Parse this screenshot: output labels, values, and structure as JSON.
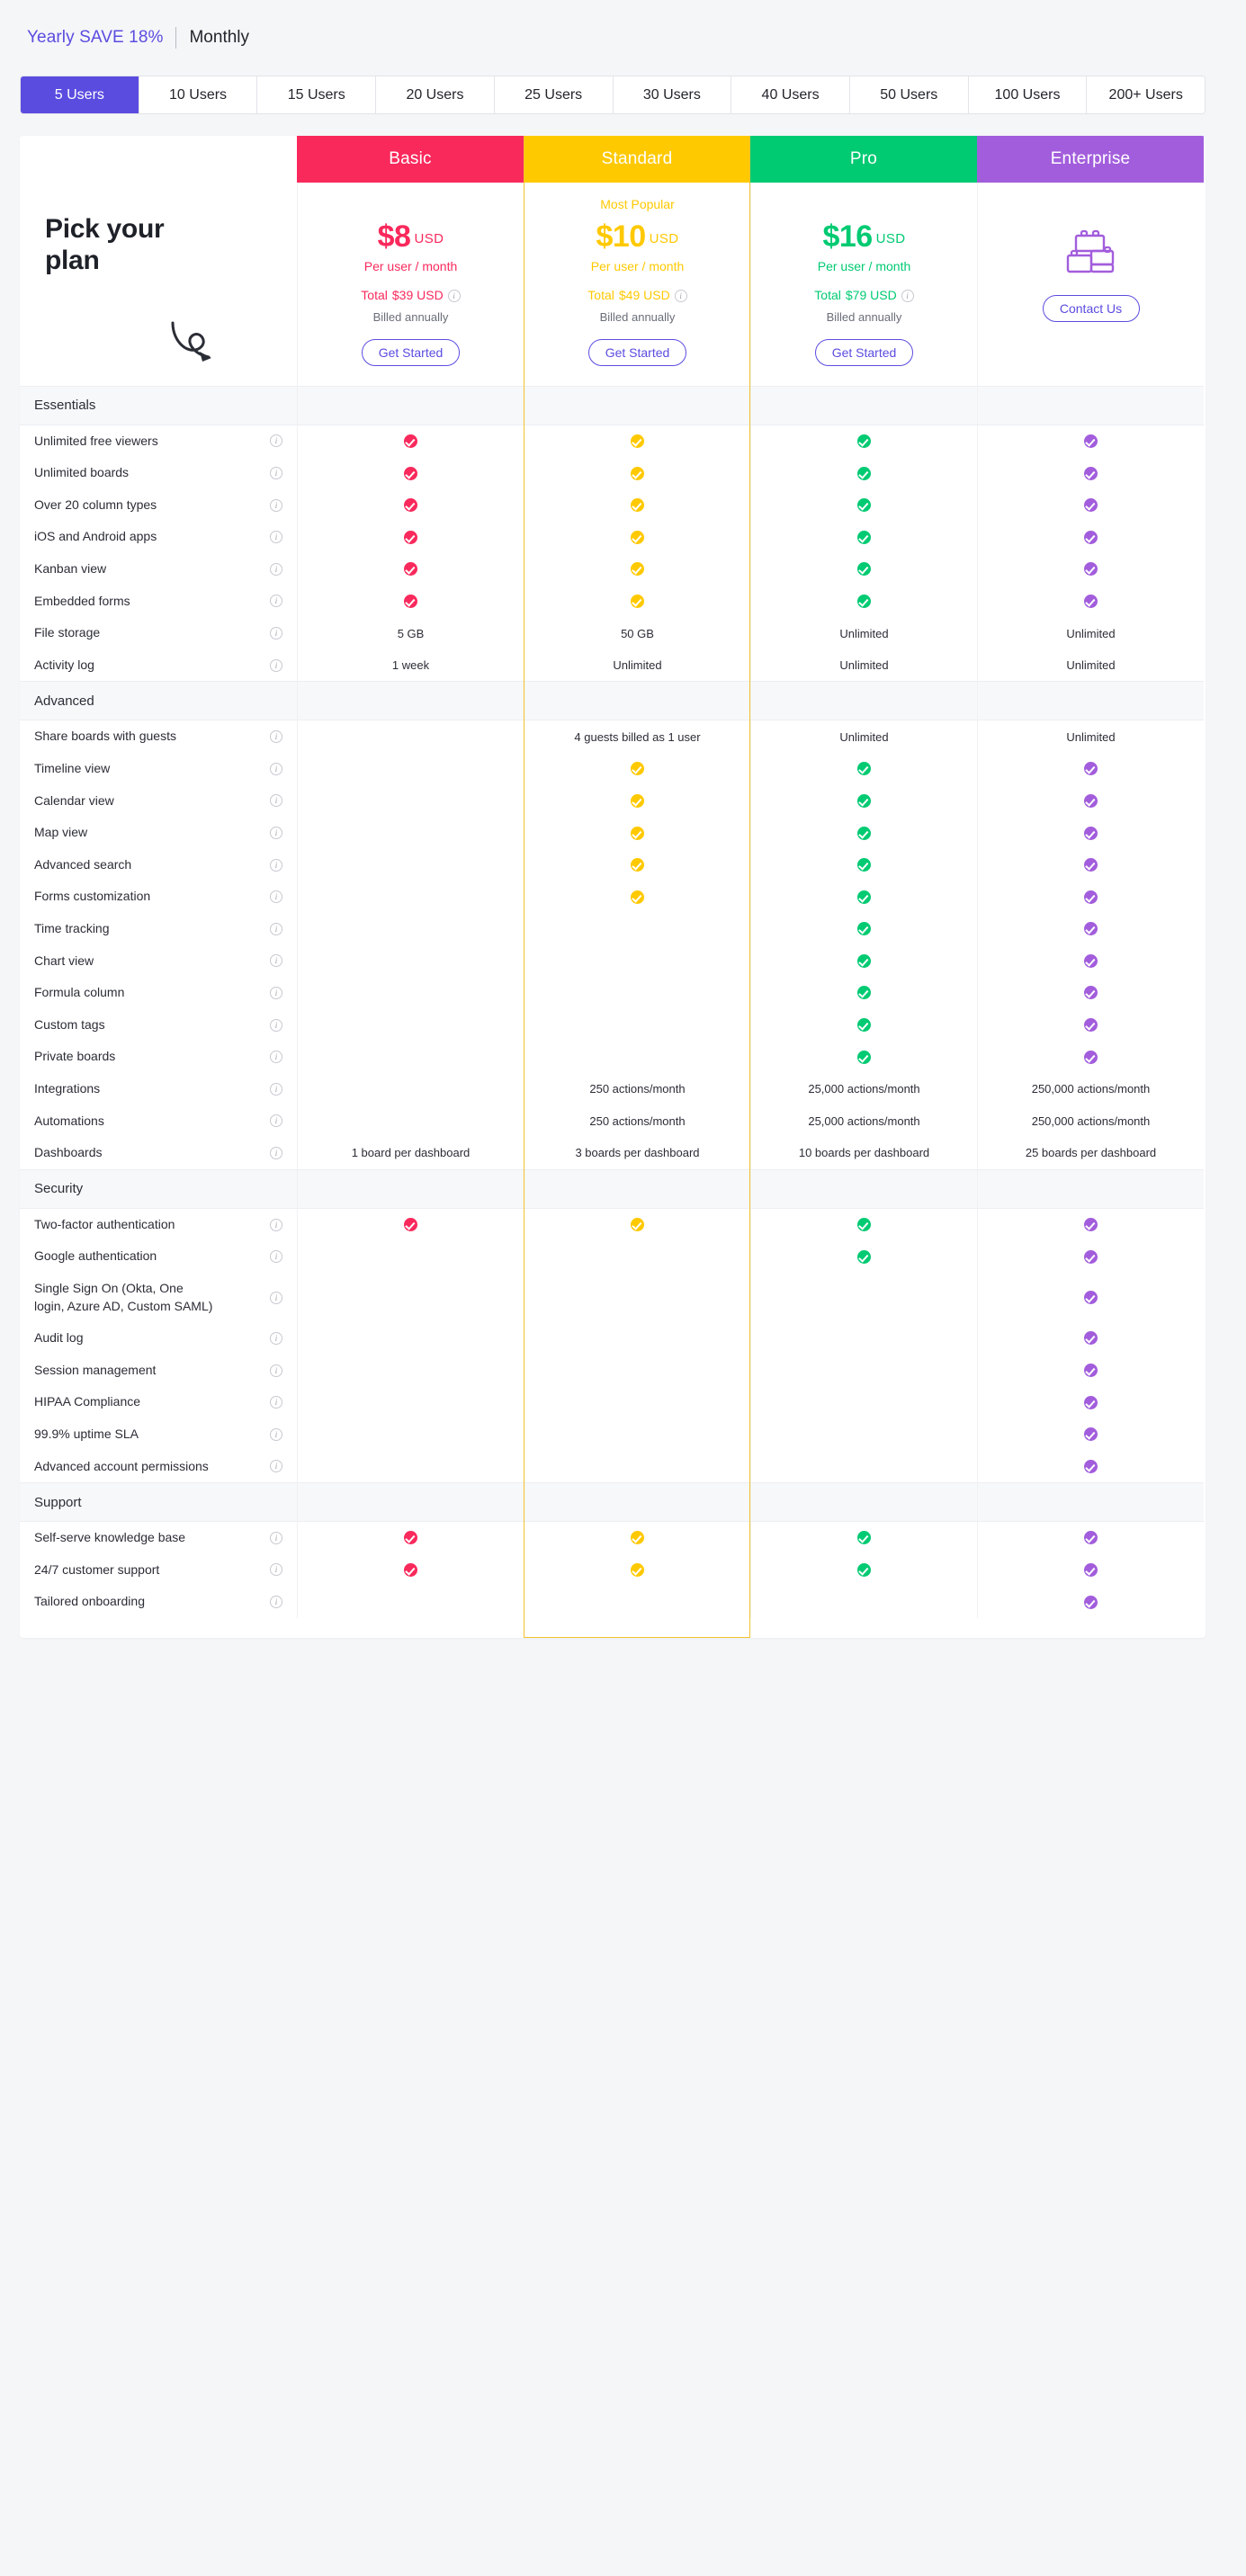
{
  "billing": {
    "yearly_label": "Yearly SAVE 18%",
    "monthly_label": "Monthly",
    "active": "Yearly"
  },
  "user_tabs": [
    {
      "label": "5 Users",
      "active": true
    },
    {
      "label": "10 Users",
      "active": false
    },
    {
      "label": "15 Users",
      "active": false
    },
    {
      "label": "20 Users",
      "active": false
    },
    {
      "label": "25 Users",
      "active": false
    },
    {
      "label": "30 Users",
      "active": false
    },
    {
      "label": "40 Users",
      "active": false
    },
    {
      "label": "50 Users",
      "active": false
    },
    {
      "label": "100 Users",
      "active": false
    },
    {
      "label": "200+ Users",
      "active": false
    }
  ],
  "pick": {
    "title": "Pick your plan",
    "arrow_icon": "curly-arrow-icon"
  },
  "colors": {
    "basic": "#f9295c",
    "standard": "#ffc900",
    "pro": "#00ca72",
    "enterprise": "#a25ddc",
    "accent": "#5b4ce0"
  },
  "plans": [
    {
      "key": "basic",
      "name": "Basic",
      "badge": "",
      "amount": "$8",
      "currency": "USD",
      "per": "Per user / month",
      "total_label": "Total",
      "total_value": "$39 USD",
      "billed": "Billed annually",
      "cta": "Get Started",
      "has_icon": false
    },
    {
      "key": "standard",
      "name": "Standard",
      "badge": "Most Popular",
      "amount": "$10",
      "currency": "USD",
      "per": "Per user / month",
      "total_label": "Total",
      "total_value": "$49 USD",
      "billed": "Billed annually",
      "cta": "Get Started",
      "has_icon": false
    },
    {
      "key": "pro",
      "name": "Pro",
      "badge": "",
      "amount": "$16",
      "currency": "USD",
      "per": "Per user / month",
      "total_label": "Total",
      "total_value": "$79 USD",
      "billed": "Billed annually",
      "cta": "Get Started",
      "has_icon": false
    },
    {
      "key": "enterprise",
      "name": "Enterprise",
      "badge": "",
      "amount": "",
      "currency": "",
      "per": "",
      "total_label": "",
      "total_value": "",
      "billed": "",
      "cta": "Contact Us",
      "has_icon": true,
      "icon_name": "building-blocks-icon"
    }
  ],
  "sections": [
    {
      "title": "Essentials",
      "rows": [
        {
          "label": "Unlimited free viewers",
          "values": [
            "check",
            "check",
            "check",
            "check"
          ]
        },
        {
          "label": "Unlimited boards",
          "values": [
            "check",
            "check",
            "check",
            "check"
          ]
        },
        {
          "label": "Over 20 column types",
          "values": [
            "check",
            "check",
            "check",
            "check"
          ]
        },
        {
          "label": "iOS and Android apps",
          "values": [
            "check",
            "check",
            "check",
            "check"
          ]
        },
        {
          "label": "Kanban view",
          "values": [
            "check",
            "check",
            "check",
            "check"
          ]
        },
        {
          "label": "Embedded forms",
          "values": [
            "check",
            "check",
            "check",
            "check"
          ]
        },
        {
          "label": "File storage",
          "values": [
            "5 GB",
            "50 GB",
            "Unlimited",
            "Unlimited"
          ]
        },
        {
          "label": "Activity log",
          "values": [
            "1 week",
            "Unlimited",
            "Unlimited",
            "Unlimited"
          ]
        }
      ]
    },
    {
      "title": "Advanced",
      "rows": [
        {
          "label": "Share boards with guests",
          "values": [
            "",
            "4 guests billed as 1 user",
            "Unlimited",
            "Unlimited"
          ]
        },
        {
          "label": "Timeline view",
          "values": [
            "",
            "check",
            "check",
            "check"
          ]
        },
        {
          "label": "Calendar view",
          "values": [
            "",
            "check",
            "check",
            "check"
          ]
        },
        {
          "label": "Map view",
          "values": [
            "",
            "check",
            "check",
            "check"
          ]
        },
        {
          "label": "Advanced search",
          "values": [
            "",
            "check",
            "check",
            "check"
          ]
        },
        {
          "label": "Forms customization",
          "values": [
            "",
            "check",
            "check",
            "check"
          ]
        },
        {
          "label": "Time tracking",
          "values": [
            "",
            "",
            "check",
            "check"
          ]
        },
        {
          "label": "Chart view",
          "values": [
            "",
            "",
            "check",
            "check"
          ]
        },
        {
          "label": "Formula column",
          "values": [
            "",
            "",
            "check",
            "check"
          ]
        },
        {
          "label": "Custom tags",
          "values": [
            "",
            "",
            "check",
            "check"
          ]
        },
        {
          "label": "Private boards",
          "values": [
            "",
            "",
            "check",
            "check"
          ]
        },
        {
          "label": "Integrations",
          "values": [
            "",
            "250 actions/month",
            "25,000 actions/month",
            "250,000 actions/month"
          ]
        },
        {
          "label": "Automations",
          "values": [
            "",
            "250 actions/month",
            "25,000 actions/month",
            "250,000 actions/month"
          ]
        },
        {
          "label": "Dashboards",
          "values": [
            "1 board per dashboard",
            "3 boards per dashboard",
            "10 boards per dashboard",
            "25 boards per dashboard"
          ]
        }
      ]
    },
    {
      "title": "Security",
      "rows": [
        {
          "label": "Two-factor authentication",
          "values": [
            "check",
            "check",
            "check",
            "check"
          ]
        },
        {
          "label": "Google authentication",
          "values": [
            "",
            "",
            "check",
            "check"
          ]
        },
        {
          "label": "Single Sign On (Okta, One login, Azure AD, Custom SAML)",
          "values": [
            "",
            "",
            "",
            "check"
          ]
        },
        {
          "label": "Audit log",
          "values": [
            "",
            "",
            "",
            "check"
          ]
        },
        {
          "label": "Session management",
          "values": [
            "",
            "",
            "",
            "check"
          ]
        },
        {
          "label": "HIPAA Compliance",
          "values": [
            "",
            "",
            "",
            "check"
          ]
        },
        {
          "label": "99.9% uptime SLA",
          "values": [
            "",
            "",
            "",
            "check"
          ]
        },
        {
          "label": "Advanced account permissions",
          "values": [
            "",
            "",
            "",
            "check"
          ]
        }
      ]
    },
    {
      "title": "Support",
      "rows": [
        {
          "label": "Self-serve knowledge base",
          "values": [
            "check",
            "check",
            "check",
            "check"
          ]
        },
        {
          "label": "24/7 customer support",
          "values": [
            "check",
            "check",
            "check",
            "check"
          ]
        },
        {
          "label": "Tailored onboarding",
          "values": [
            "",
            "",
            "",
            "check"
          ]
        }
      ]
    }
  ]
}
